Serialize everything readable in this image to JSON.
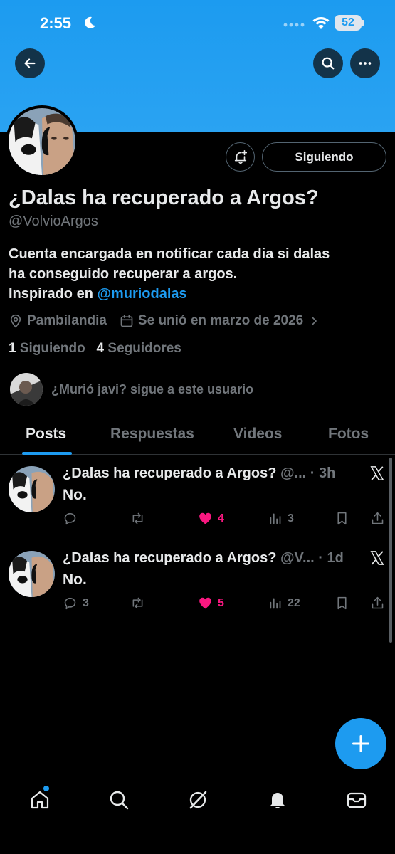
{
  "status_bar": {
    "time": "2:55",
    "battery": "52"
  },
  "header": {
    "back_icon": "arrow-left-icon",
    "search_icon": "search-icon",
    "more_icon": "more-icon"
  },
  "profile": {
    "name": "¿Dalas ha recuperado a Argos?",
    "handle": "@VolvioArgos",
    "bio_line1": "Cuenta encargada en notificar cada dia si dalas",
    "bio_line2": "ha conseguido recuperar a argos.",
    "bio_line3_prefix": "Inspirado en ",
    "bio_mention": "@muriodalas",
    "location": "Pambilandia",
    "joined": "Se unió en marzo de 2026",
    "following_count": "1",
    "following_label": "Siguiendo",
    "followers_count": "4",
    "followers_label": "Seguidores",
    "follow_button": "Siguiendo",
    "followed_by_text": "¿Murió javi? sigue a este usuario"
  },
  "tabs": [
    {
      "label": "Posts",
      "active": true
    },
    {
      "label": "Respuestas",
      "active": false
    },
    {
      "label": "Videos",
      "active": false
    },
    {
      "label": "Fotos",
      "active": false
    }
  ],
  "posts": [
    {
      "name": "¿Dalas ha recuperado a Argos?",
      "handle_trunc": "@...",
      "time": "3h",
      "text": "No.",
      "replies": "",
      "reposts": "",
      "likes": "4",
      "views": "3"
    },
    {
      "name": "¿Dalas ha recuperado a Argos?",
      "handle_trunc": "@V...",
      "time": "1d",
      "text": "No.",
      "replies": "3",
      "reposts": "",
      "likes": "5",
      "views": "22"
    }
  ],
  "colors": {
    "banner": "#1c9bf0",
    "accent": "#1d9bf0",
    "like": "#f91880",
    "muted": "#71767b",
    "text": "#e7e9ea"
  },
  "bottom_nav": [
    "home-icon",
    "search-icon",
    "grok-icon",
    "notifications-icon",
    "messages-icon"
  ]
}
